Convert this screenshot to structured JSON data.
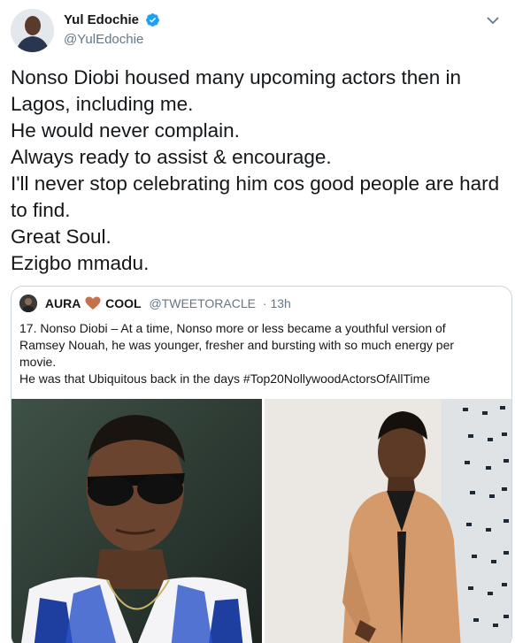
{
  "author": {
    "display_name": "Yul Edochie",
    "handle": "@YulEdochie",
    "verified_icon": "verified-badge-icon",
    "menu_icon": "chevron-down-icon"
  },
  "tweet": {
    "lines": [
      "Nonso Diobi housed many upcoming actors then in",
      "Lagos, including me.",
      "He would never complain.",
      "Always ready to assist & encourage.",
      "I'll never stop celebrating him cos good people are hard",
      "to find.",
      "Great Soul.",
      "Ezigbo mmadu."
    ]
  },
  "quoted": {
    "name_part1": "AURA",
    "name_part2": "COOL",
    "heart_icon": "heart-icon",
    "handle": "@TWEETORACLE",
    "time": "· 13h",
    "lines": [
      "17. Nonso Diobi – At a time, Nonso more or less became a youthful version of",
      "Ramsey Nouah, he was younger, fresher and bursting with so much energy per",
      "movie.",
      "He was that Ubiquitous back in the days #Top20NollywoodActorsOfAllTime"
    ]
  },
  "colors": {
    "text": "#14171a",
    "secondary": "#657786",
    "border": "#ccd6dd",
    "verified": "#1da1f2",
    "heart": "#c8704a"
  }
}
